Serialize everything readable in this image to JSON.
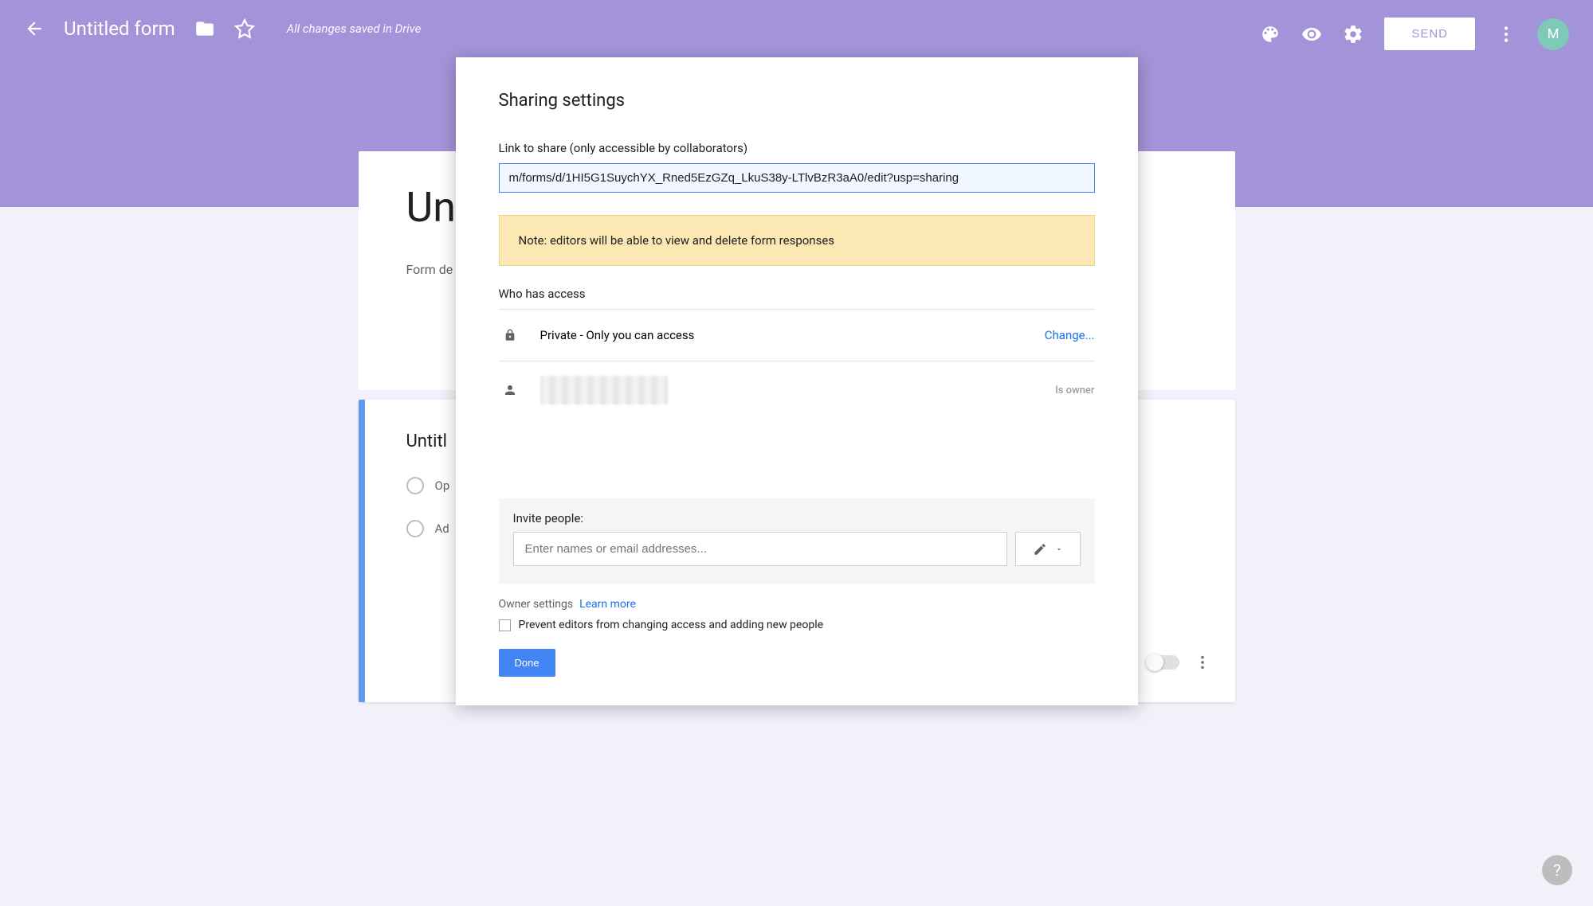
{
  "header": {
    "form_title": "Untitled form",
    "save_status": "All changes saved in Drive",
    "send_label": "SEND",
    "avatar_letter": "M"
  },
  "form_background": {
    "title_truncated": "Un",
    "description_truncated": "Form de",
    "question_title_truncated": "Untitl",
    "option1": "Op",
    "option2": "Ad"
  },
  "dialog": {
    "title": "Sharing settings",
    "link_label": "Link to share (only accessible by collaborators)",
    "link_value": "m/forms/d/1HI5G1SuychYX_Rned5EzGZq_LkuS38y-LTlvBzR3aA0/edit?usp=sharing",
    "note": "Note: editors will be able to view and delete form responses",
    "who_access_label": "Who has access",
    "access_private": "Private - Only you can access",
    "change_label": "Change...",
    "owner_label": "Is owner",
    "invite_label": "Invite people:",
    "invite_placeholder": "Enter names or email addresses...",
    "owner_settings": "Owner settings",
    "learn_more": "Learn more",
    "prevent_editors": "Prevent editors from changing access and adding new people",
    "done_label": "Done"
  }
}
